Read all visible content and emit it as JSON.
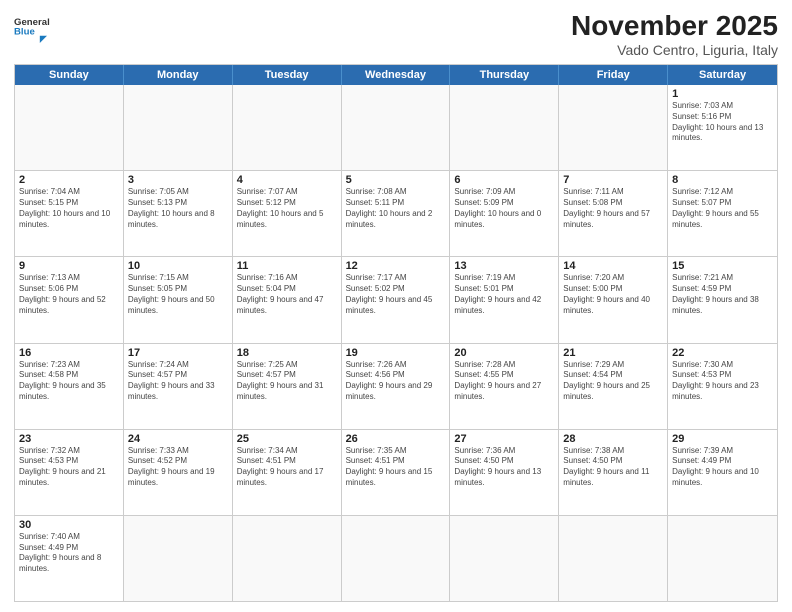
{
  "header": {
    "logo_general": "General",
    "logo_blue": "Blue",
    "title": "November 2025",
    "subtitle": "Vado Centro, Liguria, Italy"
  },
  "calendar": {
    "days_of_week": [
      "Sunday",
      "Monday",
      "Tuesday",
      "Wednesday",
      "Thursday",
      "Friday",
      "Saturday"
    ],
    "weeks": [
      [
        {
          "day": "",
          "info": ""
        },
        {
          "day": "",
          "info": ""
        },
        {
          "day": "",
          "info": ""
        },
        {
          "day": "",
          "info": ""
        },
        {
          "day": "",
          "info": ""
        },
        {
          "day": "",
          "info": ""
        },
        {
          "day": "1",
          "info": "Sunrise: 7:03 AM\nSunset: 5:16 PM\nDaylight: 10 hours and 13 minutes."
        }
      ],
      [
        {
          "day": "2",
          "info": "Sunrise: 7:04 AM\nSunset: 5:15 PM\nDaylight: 10 hours and 10 minutes."
        },
        {
          "day": "3",
          "info": "Sunrise: 7:05 AM\nSunset: 5:13 PM\nDaylight: 10 hours and 8 minutes."
        },
        {
          "day": "4",
          "info": "Sunrise: 7:07 AM\nSunset: 5:12 PM\nDaylight: 10 hours and 5 minutes."
        },
        {
          "day": "5",
          "info": "Sunrise: 7:08 AM\nSunset: 5:11 PM\nDaylight: 10 hours and 2 minutes."
        },
        {
          "day": "6",
          "info": "Sunrise: 7:09 AM\nSunset: 5:09 PM\nDaylight: 10 hours and 0 minutes."
        },
        {
          "day": "7",
          "info": "Sunrise: 7:11 AM\nSunset: 5:08 PM\nDaylight: 9 hours and 57 minutes."
        },
        {
          "day": "8",
          "info": "Sunrise: 7:12 AM\nSunset: 5:07 PM\nDaylight: 9 hours and 55 minutes."
        }
      ],
      [
        {
          "day": "9",
          "info": "Sunrise: 7:13 AM\nSunset: 5:06 PM\nDaylight: 9 hours and 52 minutes."
        },
        {
          "day": "10",
          "info": "Sunrise: 7:15 AM\nSunset: 5:05 PM\nDaylight: 9 hours and 50 minutes."
        },
        {
          "day": "11",
          "info": "Sunrise: 7:16 AM\nSunset: 5:04 PM\nDaylight: 9 hours and 47 minutes."
        },
        {
          "day": "12",
          "info": "Sunrise: 7:17 AM\nSunset: 5:02 PM\nDaylight: 9 hours and 45 minutes."
        },
        {
          "day": "13",
          "info": "Sunrise: 7:19 AM\nSunset: 5:01 PM\nDaylight: 9 hours and 42 minutes."
        },
        {
          "day": "14",
          "info": "Sunrise: 7:20 AM\nSunset: 5:00 PM\nDaylight: 9 hours and 40 minutes."
        },
        {
          "day": "15",
          "info": "Sunrise: 7:21 AM\nSunset: 4:59 PM\nDaylight: 9 hours and 38 minutes."
        }
      ],
      [
        {
          "day": "16",
          "info": "Sunrise: 7:23 AM\nSunset: 4:58 PM\nDaylight: 9 hours and 35 minutes."
        },
        {
          "day": "17",
          "info": "Sunrise: 7:24 AM\nSunset: 4:57 PM\nDaylight: 9 hours and 33 minutes."
        },
        {
          "day": "18",
          "info": "Sunrise: 7:25 AM\nSunset: 4:57 PM\nDaylight: 9 hours and 31 minutes."
        },
        {
          "day": "19",
          "info": "Sunrise: 7:26 AM\nSunset: 4:56 PM\nDaylight: 9 hours and 29 minutes."
        },
        {
          "day": "20",
          "info": "Sunrise: 7:28 AM\nSunset: 4:55 PM\nDaylight: 9 hours and 27 minutes."
        },
        {
          "day": "21",
          "info": "Sunrise: 7:29 AM\nSunset: 4:54 PM\nDaylight: 9 hours and 25 minutes."
        },
        {
          "day": "22",
          "info": "Sunrise: 7:30 AM\nSunset: 4:53 PM\nDaylight: 9 hours and 23 minutes."
        }
      ],
      [
        {
          "day": "23",
          "info": "Sunrise: 7:32 AM\nSunset: 4:53 PM\nDaylight: 9 hours and 21 minutes."
        },
        {
          "day": "24",
          "info": "Sunrise: 7:33 AM\nSunset: 4:52 PM\nDaylight: 9 hours and 19 minutes."
        },
        {
          "day": "25",
          "info": "Sunrise: 7:34 AM\nSunset: 4:51 PM\nDaylight: 9 hours and 17 minutes."
        },
        {
          "day": "26",
          "info": "Sunrise: 7:35 AM\nSunset: 4:51 PM\nDaylight: 9 hours and 15 minutes."
        },
        {
          "day": "27",
          "info": "Sunrise: 7:36 AM\nSunset: 4:50 PM\nDaylight: 9 hours and 13 minutes."
        },
        {
          "day": "28",
          "info": "Sunrise: 7:38 AM\nSunset: 4:50 PM\nDaylight: 9 hours and 11 minutes."
        },
        {
          "day": "29",
          "info": "Sunrise: 7:39 AM\nSunset: 4:49 PM\nDaylight: 9 hours and 10 minutes."
        }
      ],
      [
        {
          "day": "30",
          "info": "Sunrise: 7:40 AM\nSunset: 4:49 PM\nDaylight: 9 hours and 8 minutes."
        },
        {
          "day": "",
          "info": ""
        },
        {
          "day": "",
          "info": ""
        },
        {
          "day": "",
          "info": ""
        },
        {
          "day": "",
          "info": ""
        },
        {
          "day": "",
          "info": ""
        },
        {
          "day": "",
          "info": ""
        }
      ]
    ]
  }
}
